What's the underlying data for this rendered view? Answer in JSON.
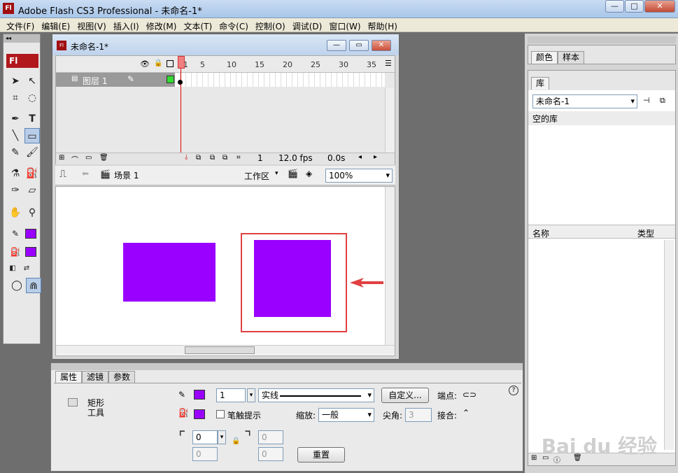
{
  "app": {
    "title": "Adobe Flash CS3 Professional - 未命名-1*",
    "logo": "Fl"
  },
  "menu": [
    "文件(F)",
    "编辑(E)",
    "视图(V)",
    "插入(I)",
    "修改(M)",
    "文本(T)",
    "命令(C)",
    "控制(O)",
    "调试(D)",
    "窗口(W)",
    "帮助(H)"
  ],
  "tools": {
    "logo": "Fl",
    "text_tool": "T"
  },
  "document": {
    "title": "未命名-1*",
    "timeline": {
      "frame_numbers": [
        "1",
        "5",
        "10",
        "15",
        "20",
        "25",
        "30",
        "35"
      ],
      "layer_name": "图层 1",
      "current_frame": "1",
      "fps": "12.0 fps",
      "time": "0.0s"
    },
    "editbar": {
      "scene": "场景 1",
      "workspace": "工作区",
      "zoom": "100%"
    }
  },
  "right": {
    "top_tabs": [
      "颜色",
      "样本"
    ],
    "library_tab": "库",
    "library_doc": "未命名-1",
    "library_empty": "空的库",
    "col_name": "名称",
    "col_type": "类型"
  },
  "properties": {
    "tabs": [
      "属性",
      "滤镜",
      "参数"
    ],
    "tool_name": "矩形",
    "tool_name2": "工具",
    "stroke_height": "1",
    "stroke_style": "实线",
    "custom_btn": "自定义...",
    "cap_label": "端点:",
    "hinting_label": "笔触提示",
    "scale_label": "缩放:",
    "scale_value": "一般",
    "miter_label": "尖角:",
    "miter_value": "3",
    "join_label": "接合:",
    "corner_tl": "0",
    "corner_tr": "0",
    "corner_bl": "0",
    "corner_br": "0",
    "reset_btn": "重置",
    "help": "?"
  },
  "colors": {
    "fill": "#9900ff",
    "highlight": "#e04040"
  }
}
